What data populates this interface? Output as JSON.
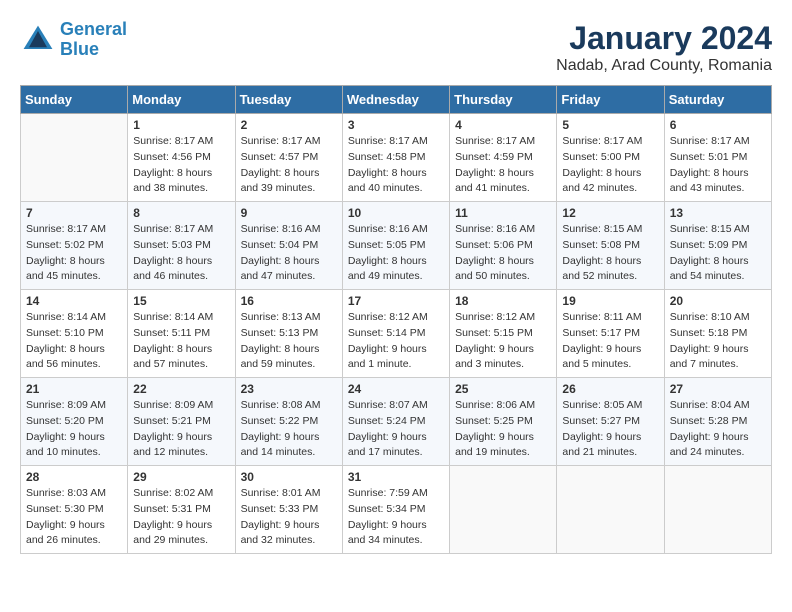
{
  "header": {
    "logo_line1": "General",
    "logo_line2": "Blue",
    "title": "January 2024",
    "subtitle": "Nadab, Arad County, Romania"
  },
  "calendar": {
    "days_of_week": [
      "Sunday",
      "Monday",
      "Tuesday",
      "Wednesday",
      "Thursday",
      "Friday",
      "Saturday"
    ],
    "weeks": [
      [
        {
          "day": "",
          "info": ""
        },
        {
          "day": "1",
          "info": "Sunrise: 8:17 AM\nSunset: 4:56 PM\nDaylight: 8 hours\nand 38 minutes."
        },
        {
          "day": "2",
          "info": "Sunrise: 8:17 AM\nSunset: 4:57 PM\nDaylight: 8 hours\nand 39 minutes."
        },
        {
          "day": "3",
          "info": "Sunrise: 8:17 AM\nSunset: 4:58 PM\nDaylight: 8 hours\nand 40 minutes."
        },
        {
          "day": "4",
          "info": "Sunrise: 8:17 AM\nSunset: 4:59 PM\nDaylight: 8 hours\nand 41 minutes."
        },
        {
          "day": "5",
          "info": "Sunrise: 8:17 AM\nSunset: 5:00 PM\nDaylight: 8 hours\nand 42 minutes."
        },
        {
          "day": "6",
          "info": "Sunrise: 8:17 AM\nSunset: 5:01 PM\nDaylight: 8 hours\nand 43 minutes."
        }
      ],
      [
        {
          "day": "7",
          "info": "Sunrise: 8:17 AM\nSunset: 5:02 PM\nDaylight: 8 hours\nand 45 minutes."
        },
        {
          "day": "8",
          "info": "Sunrise: 8:17 AM\nSunset: 5:03 PM\nDaylight: 8 hours\nand 46 minutes."
        },
        {
          "day": "9",
          "info": "Sunrise: 8:16 AM\nSunset: 5:04 PM\nDaylight: 8 hours\nand 47 minutes."
        },
        {
          "day": "10",
          "info": "Sunrise: 8:16 AM\nSunset: 5:05 PM\nDaylight: 8 hours\nand 49 minutes."
        },
        {
          "day": "11",
          "info": "Sunrise: 8:16 AM\nSunset: 5:06 PM\nDaylight: 8 hours\nand 50 minutes."
        },
        {
          "day": "12",
          "info": "Sunrise: 8:15 AM\nSunset: 5:08 PM\nDaylight: 8 hours\nand 52 minutes."
        },
        {
          "day": "13",
          "info": "Sunrise: 8:15 AM\nSunset: 5:09 PM\nDaylight: 8 hours\nand 54 minutes."
        }
      ],
      [
        {
          "day": "14",
          "info": "Sunrise: 8:14 AM\nSunset: 5:10 PM\nDaylight: 8 hours\nand 56 minutes."
        },
        {
          "day": "15",
          "info": "Sunrise: 8:14 AM\nSunset: 5:11 PM\nDaylight: 8 hours\nand 57 minutes."
        },
        {
          "day": "16",
          "info": "Sunrise: 8:13 AM\nSunset: 5:13 PM\nDaylight: 8 hours\nand 59 minutes."
        },
        {
          "day": "17",
          "info": "Sunrise: 8:12 AM\nSunset: 5:14 PM\nDaylight: 9 hours\nand 1 minute."
        },
        {
          "day": "18",
          "info": "Sunrise: 8:12 AM\nSunset: 5:15 PM\nDaylight: 9 hours\nand 3 minutes."
        },
        {
          "day": "19",
          "info": "Sunrise: 8:11 AM\nSunset: 5:17 PM\nDaylight: 9 hours\nand 5 minutes."
        },
        {
          "day": "20",
          "info": "Sunrise: 8:10 AM\nSunset: 5:18 PM\nDaylight: 9 hours\nand 7 minutes."
        }
      ],
      [
        {
          "day": "21",
          "info": "Sunrise: 8:09 AM\nSunset: 5:20 PM\nDaylight: 9 hours\nand 10 minutes."
        },
        {
          "day": "22",
          "info": "Sunrise: 8:09 AM\nSunset: 5:21 PM\nDaylight: 9 hours\nand 12 minutes."
        },
        {
          "day": "23",
          "info": "Sunrise: 8:08 AM\nSunset: 5:22 PM\nDaylight: 9 hours\nand 14 minutes."
        },
        {
          "day": "24",
          "info": "Sunrise: 8:07 AM\nSunset: 5:24 PM\nDaylight: 9 hours\nand 17 minutes."
        },
        {
          "day": "25",
          "info": "Sunrise: 8:06 AM\nSunset: 5:25 PM\nDaylight: 9 hours\nand 19 minutes."
        },
        {
          "day": "26",
          "info": "Sunrise: 8:05 AM\nSunset: 5:27 PM\nDaylight: 9 hours\nand 21 minutes."
        },
        {
          "day": "27",
          "info": "Sunrise: 8:04 AM\nSunset: 5:28 PM\nDaylight: 9 hours\nand 24 minutes."
        }
      ],
      [
        {
          "day": "28",
          "info": "Sunrise: 8:03 AM\nSunset: 5:30 PM\nDaylight: 9 hours\nand 26 minutes."
        },
        {
          "day": "29",
          "info": "Sunrise: 8:02 AM\nSunset: 5:31 PM\nDaylight: 9 hours\nand 29 minutes."
        },
        {
          "day": "30",
          "info": "Sunrise: 8:01 AM\nSunset: 5:33 PM\nDaylight: 9 hours\nand 32 minutes."
        },
        {
          "day": "31",
          "info": "Sunrise: 7:59 AM\nSunset: 5:34 PM\nDaylight: 9 hours\nand 34 minutes."
        },
        {
          "day": "",
          "info": ""
        },
        {
          "day": "",
          "info": ""
        },
        {
          "day": "",
          "info": ""
        }
      ]
    ]
  }
}
